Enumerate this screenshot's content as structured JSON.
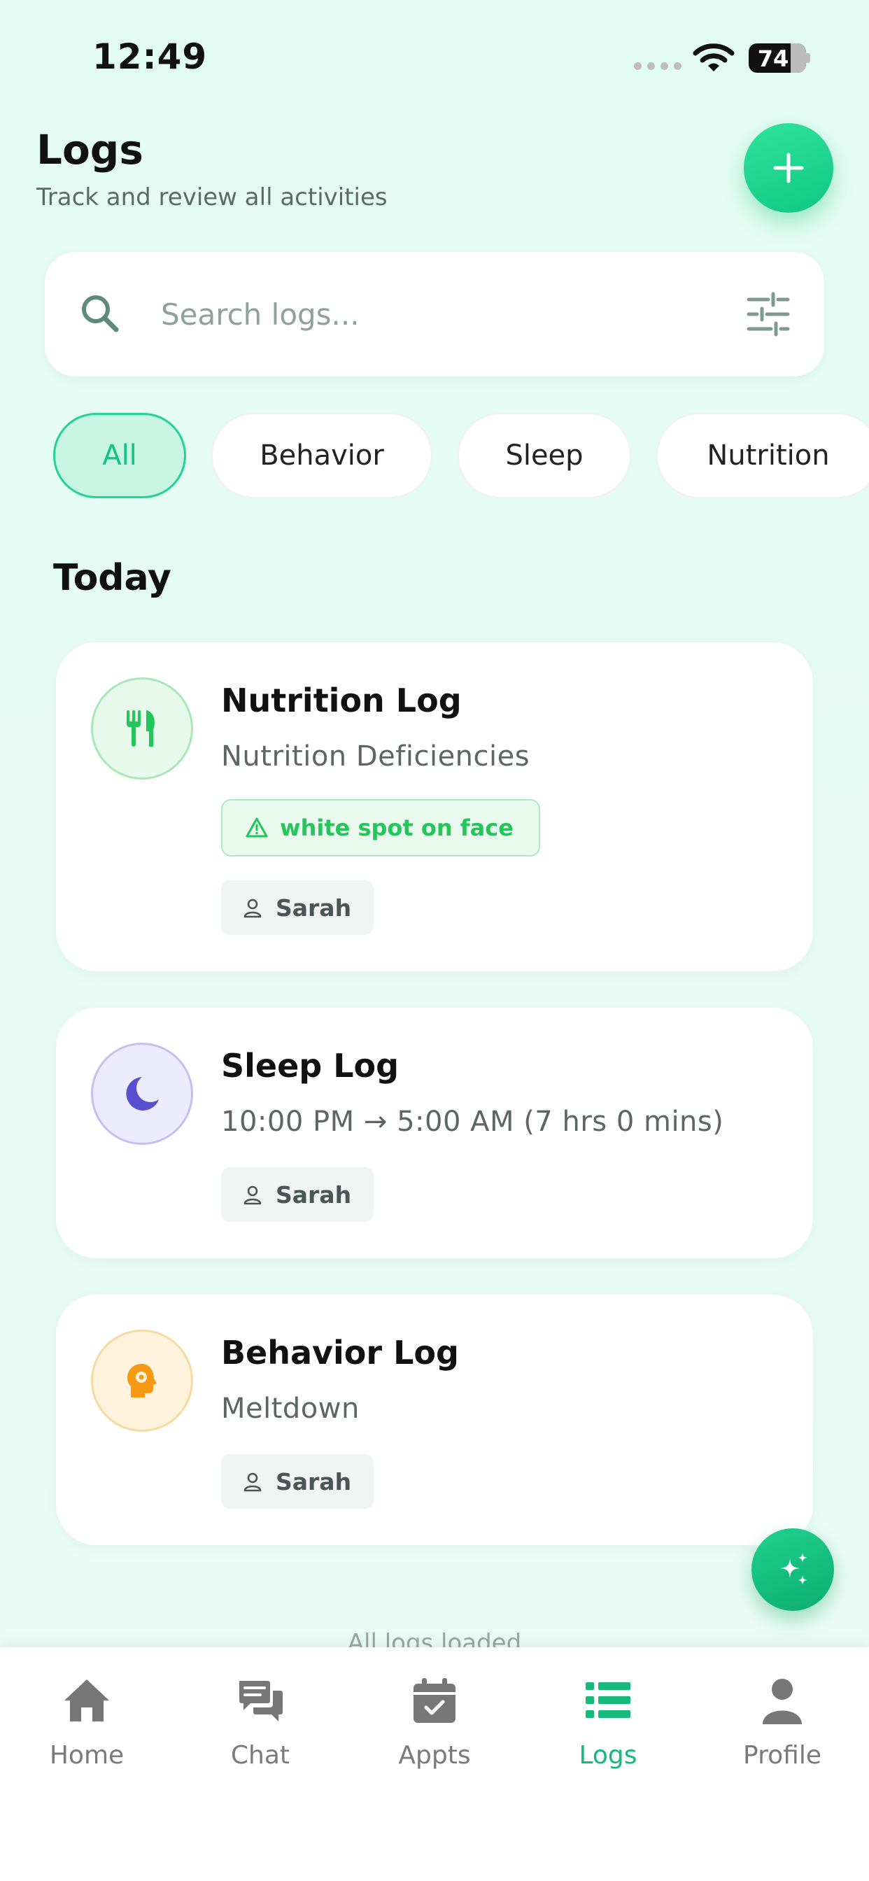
{
  "status_bar": {
    "time": "12:49",
    "battery": "74"
  },
  "header": {
    "title": "Logs",
    "subtitle": "Track and review all activities"
  },
  "search": {
    "placeholder": "Search logs..."
  },
  "filters": [
    "All",
    "Behavior",
    "Sleep",
    "Nutrition"
  ],
  "section_title": "Today",
  "logs": [
    {
      "title": "Nutrition Log",
      "subtitle": "Nutrition Deficiencies",
      "tag": "white spot on face",
      "person": "Sarah",
      "icon": "utensils-icon",
      "color": "#22c65a"
    },
    {
      "title": "Sleep Log",
      "subtitle": "10:00 PM → 5:00 AM (7 hrs 0 mins)",
      "person": "Sarah",
      "icon": "moon-icon",
      "color": "#6a5cd8"
    },
    {
      "title": "Behavior Log",
      "subtitle": "Meltdown",
      "person": "Sarah",
      "icon": "brain-gear-icon",
      "color": "#f59a12"
    }
  ],
  "footer_note": "All logs loaded",
  "tab_bar": {
    "items": [
      {
        "label": "Home",
        "icon": "home-icon"
      },
      {
        "label": "Chat",
        "icon": "chat-icon"
      },
      {
        "label": "Appts",
        "icon": "calendar-icon"
      },
      {
        "label": "Logs",
        "icon": "list-icon"
      },
      {
        "label": "Profile",
        "icon": "user-icon"
      }
    ],
    "active": "Logs"
  },
  "colors": {
    "accent": "#16b87b",
    "background": "#e3fcf3"
  }
}
